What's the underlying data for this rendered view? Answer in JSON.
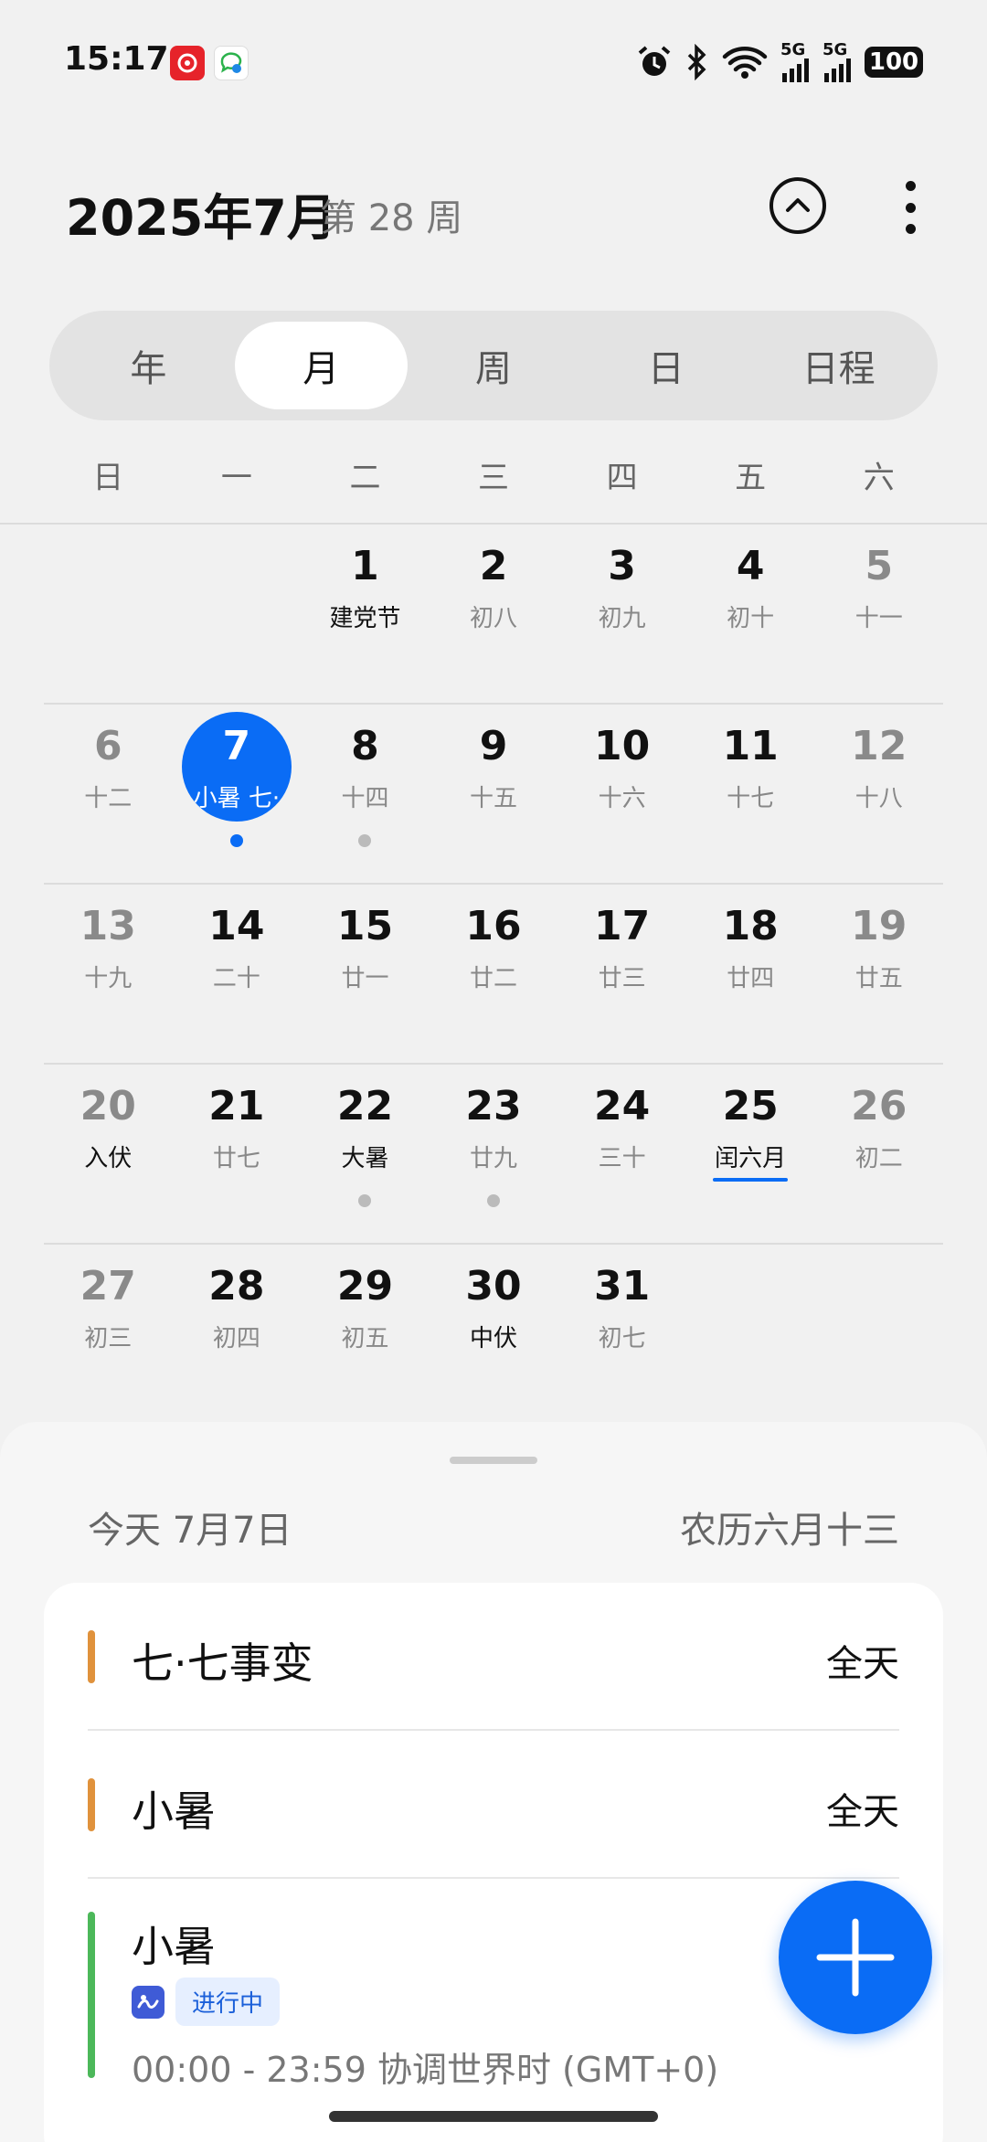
{
  "status_bar": {
    "time": "15:17",
    "battery": "100",
    "net1": "5G",
    "net2": "5G"
  },
  "header": {
    "title": "2025年7月",
    "week": "第 28 周"
  },
  "tabs": [
    {
      "label": "年"
    },
    {
      "label": "月"
    },
    {
      "label": "周"
    },
    {
      "label": "日"
    },
    {
      "label": "日程"
    }
  ],
  "weekdays": [
    "日",
    "一",
    "二",
    "三",
    "四",
    "五",
    "六"
  ],
  "weeks": [
    [
      {
        "num": "",
        "lunar": ""
      },
      {
        "num": "",
        "lunar": ""
      },
      {
        "num": "1",
        "lunar": "建党节"
      },
      {
        "num": "2",
        "lunar": "初八"
      },
      {
        "num": "3",
        "lunar": "初九"
      },
      {
        "num": "4",
        "lunar": "初十"
      },
      {
        "num": "5",
        "lunar": "十一"
      }
    ],
    [
      {
        "num": "6",
        "lunar": "十二"
      },
      {
        "num": "7",
        "lunar": "小暑 七·"
      },
      {
        "num": "8",
        "lunar": "十四"
      },
      {
        "num": "9",
        "lunar": "十五"
      },
      {
        "num": "10",
        "lunar": "十六"
      },
      {
        "num": "11",
        "lunar": "十七"
      },
      {
        "num": "12",
        "lunar": "十八"
      }
    ],
    [
      {
        "num": "13",
        "lunar": "十九"
      },
      {
        "num": "14",
        "lunar": "二十"
      },
      {
        "num": "15",
        "lunar": "廿一"
      },
      {
        "num": "16",
        "lunar": "廿二"
      },
      {
        "num": "17",
        "lunar": "廿三"
      },
      {
        "num": "18",
        "lunar": "廿四"
      },
      {
        "num": "19",
        "lunar": "廿五"
      }
    ],
    [
      {
        "num": "20",
        "lunar": "入伏"
      },
      {
        "num": "21",
        "lunar": "廿七"
      },
      {
        "num": "22",
        "lunar": "大暑"
      },
      {
        "num": "23",
        "lunar": "廿九"
      },
      {
        "num": "24",
        "lunar": "三十"
      },
      {
        "num": "25",
        "lunar": "闰六月"
      },
      {
        "num": "26",
        "lunar": "初二"
      }
    ],
    [
      {
        "num": "27",
        "lunar": "初三"
      },
      {
        "num": "28",
        "lunar": "初四"
      },
      {
        "num": "29",
        "lunar": "初五"
      },
      {
        "num": "30",
        "lunar": "中伏"
      },
      {
        "num": "31",
        "lunar": "初七"
      },
      {
        "num": "",
        "lunar": ""
      },
      {
        "num": "",
        "lunar": ""
      }
    ]
  ],
  "agenda": {
    "today_label": "今天  7月7日",
    "lunar_date": "农历六月十三",
    "events": [
      {
        "title": "七·七事变",
        "time": "全天"
      },
      {
        "title": "小暑",
        "time": "全天"
      },
      {
        "title": "小暑",
        "badge": "进行中",
        "range": "00:00 - 23:59 协调世界时 (GMT+0)"
      }
    ]
  },
  "colors": {
    "accent": "#0a6cf5",
    "holiday_bar": "#e0923c",
    "solar_term_bar": "#4cb85a"
  }
}
